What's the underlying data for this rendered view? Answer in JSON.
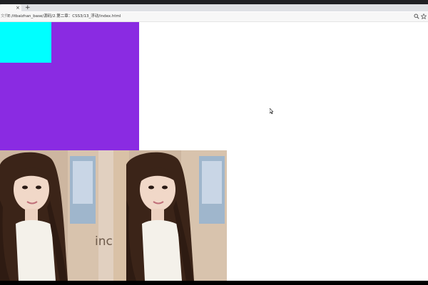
{
  "browser": {
    "tab_close": "×",
    "new_tab": "+",
    "address_prefix": "文件",
    "url": "E:/itbaizhan_base/源码/2.第二章：CSS3/13_浮动/index.html",
    "icons": [
      "zoom-icon",
      "bookmark-star-icon",
      "close-icon",
      "plus-icon"
    ]
  },
  "page": {
    "colors": {
      "purple_box": "#8a2be2",
      "cyan_box": "#00ffff",
      "background": "#ffffff"
    },
    "photos": [
      {
        "name": "photo-1",
        "sign_text": "inc"
      },
      {
        "name": "photo-2",
        "sign_text": ""
      }
    ]
  }
}
